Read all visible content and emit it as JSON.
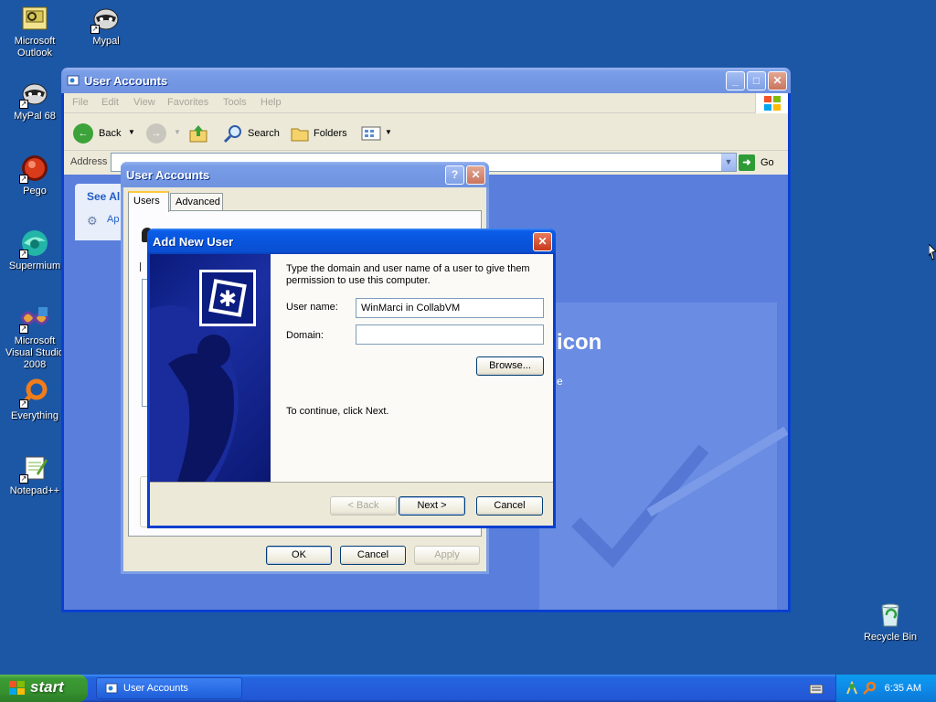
{
  "desktop": {
    "icons": [
      {
        "label": "Microsoft Outlook"
      },
      {
        "label": "Mypal"
      },
      {
        "label": "MyPal 68"
      },
      {
        "label": "Pego"
      },
      {
        "label": "Supermium"
      },
      {
        "label": "Microsoft Visual Studio 2008"
      },
      {
        "label": "Everything"
      },
      {
        "label": "Notepad++"
      },
      {
        "label": "Recycle Bin"
      }
    ]
  },
  "explorer": {
    "title": "User Accounts",
    "menu": [
      "File",
      "Edit",
      "View",
      "Favorites",
      "Tools",
      "Help"
    ],
    "toolbar": {
      "back": "Back",
      "search": "Search",
      "folders": "Folders"
    },
    "address_label": "Address",
    "go_label": "Go",
    "see_also": {
      "heading": "See Als",
      "item": "Ap"
    },
    "bg_heading": "icon",
    "bg_line": "e"
  },
  "ua_dialog": {
    "title": "User Accounts",
    "tabs": [
      "Users",
      "Advanced"
    ],
    "ok": "OK",
    "cancel": "Cancel",
    "apply": "Apply"
  },
  "add_user": {
    "title": "Add New User",
    "intro": "Type the domain and user name of a user to give them permission to use this computer.",
    "username_label": "User name:",
    "username_value": "WinMarci in CollabVM",
    "domain_label": "Domain:",
    "domain_value": "",
    "browse": "Browse...",
    "continue_text": "To continue, click Next.",
    "back": "< Back",
    "next": "Next >",
    "cancel": "Cancel"
  },
  "taskbar": {
    "start": "start",
    "task": "User Accounts",
    "clock": "6:35 AM"
  }
}
